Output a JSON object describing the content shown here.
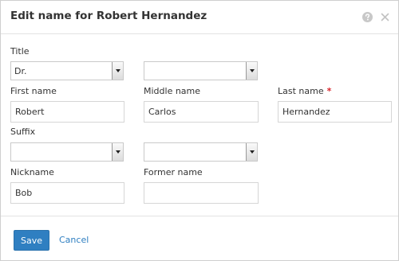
{
  "dialog": {
    "title": "Edit name for Robert Hernandez",
    "help_icon": "question-circle-icon",
    "close_icon": "close-icon"
  },
  "fields": {
    "title_label": "Title",
    "title_value": "Dr.",
    "title_secondary_value": "",
    "first_name_label": "First name",
    "first_name_value": "Robert",
    "middle_name_label": "Middle name",
    "middle_name_value": "Carlos",
    "last_name_label": "Last name",
    "last_name_required_marker": "*",
    "last_name_value": "Hernandez",
    "suffix_label": "Suffix",
    "suffix_value": "",
    "suffix_secondary_value": "",
    "nickname_label": "Nickname",
    "nickname_value": "Bob",
    "former_name_label": "Former name",
    "former_name_value": ""
  },
  "footer": {
    "save_label": "Save",
    "cancel_label": "Cancel"
  },
  "colors": {
    "primary": "#2f7fc1",
    "required": "#d9262c",
    "border": "#cfcfcf"
  }
}
